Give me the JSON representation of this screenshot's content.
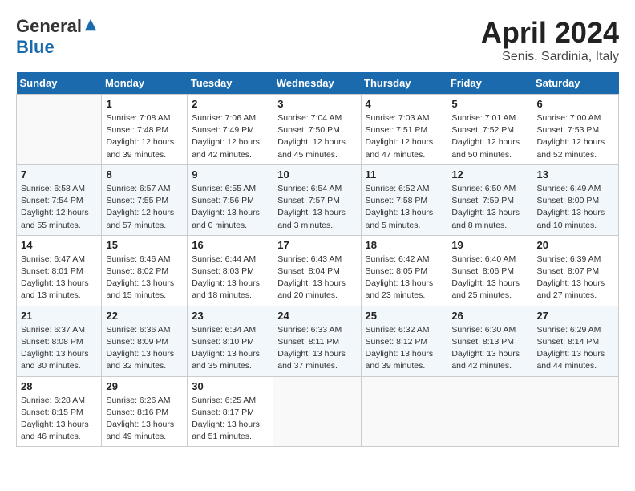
{
  "header": {
    "logo_general": "General",
    "logo_blue": "Blue",
    "month_title": "April 2024",
    "subtitle": "Senis, Sardinia, Italy"
  },
  "days_of_week": [
    "Sunday",
    "Monday",
    "Tuesday",
    "Wednesday",
    "Thursday",
    "Friday",
    "Saturday"
  ],
  "weeks": [
    [
      {
        "day": "",
        "empty": true
      },
      {
        "day": "1",
        "sunrise": "Sunrise: 7:08 AM",
        "sunset": "Sunset: 7:48 PM",
        "daylight": "Daylight: 12 hours and 39 minutes."
      },
      {
        "day": "2",
        "sunrise": "Sunrise: 7:06 AM",
        "sunset": "Sunset: 7:49 PM",
        "daylight": "Daylight: 12 hours and 42 minutes."
      },
      {
        "day": "3",
        "sunrise": "Sunrise: 7:04 AM",
        "sunset": "Sunset: 7:50 PM",
        "daylight": "Daylight: 12 hours and 45 minutes."
      },
      {
        "day": "4",
        "sunrise": "Sunrise: 7:03 AM",
        "sunset": "Sunset: 7:51 PM",
        "daylight": "Daylight: 12 hours and 47 minutes."
      },
      {
        "day": "5",
        "sunrise": "Sunrise: 7:01 AM",
        "sunset": "Sunset: 7:52 PM",
        "daylight": "Daylight: 12 hours and 50 minutes."
      },
      {
        "day": "6",
        "sunrise": "Sunrise: 7:00 AM",
        "sunset": "Sunset: 7:53 PM",
        "daylight": "Daylight: 12 hours and 52 minutes."
      }
    ],
    [
      {
        "day": "7",
        "sunrise": "Sunrise: 6:58 AM",
        "sunset": "Sunset: 7:54 PM",
        "daylight": "Daylight: 12 hours and 55 minutes."
      },
      {
        "day": "8",
        "sunrise": "Sunrise: 6:57 AM",
        "sunset": "Sunset: 7:55 PM",
        "daylight": "Daylight: 12 hours and 57 minutes."
      },
      {
        "day": "9",
        "sunrise": "Sunrise: 6:55 AM",
        "sunset": "Sunset: 7:56 PM",
        "daylight": "Daylight: 13 hours and 0 minutes."
      },
      {
        "day": "10",
        "sunrise": "Sunrise: 6:54 AM",
        "sunset": "Sunset: 7:57 PM",
        "daylight": "Daylight: 13 hours and 3 minutes."
      },
      {
        "day": "11",
        "sunrise": "Sunrise: 6:52 AM",
        "sunset": "Sunset: 7:58 PM",
        "daylight": "Daylight: 13 hours and 5 minutes."
      },
      {
        "day": "12",
        "sunrise": "Sunrise: 6:50 AM",
        "sunset": "Sunset: 7:59 PM",
        "daylight": "Daylight: 13 hours and 8 minutes."
      },
      {
        "day": "13",
        "sunrise": "Sunrise: 6:49 AM",
        "sunset": "Sunset: 8:00 PM",
        "daylight": "Daylight: 13 hours and 10 minutes."
      }
    ],
    [
      {
        "day": "14",
        "sunrise": "Sunrise: 6:47 AM",
        "sunset": "Sunset: 8:01 PM",
        "daylight": "Daylight: 13 hours and 13 minutes."
      },
      {
        "day": "15",
        "sunrise": "Sunrise: 6:46 AM",
        "sunset": "Sunset: 8:02 PM",
        "daylight": "Daylight: 13 hours and 15 minutes."
      },
      {
        "day": "16",
        "sunrise": "Sunrise: 6:44 AM",
        "sunset": "Sunset: 8:03 PM",
        "daylight": "Daylight: 13 hours and 18 minutes."
      },
      {
        "day": "17",
        "sunrise": "Sunrise: 6:43 AM",
        "sunset": "Sunset: 8:04 PM",
        "daylight": "Daylight: 13 hours and 20 minutes."
      },
      {
        "day": "18",
        "sunrise": "Sunrise: 6:42 AM",
        "sunset": "Sunset: 8:05 PM",
        "daylight": "Daylight: 13 hours and 23 minutes."
      },
      {
        "day": "19",
        "sunrise": "Sunrise: 6:40 AM",
        "sunset": "Sunset: 8:06 PM",
        "daylight": "Daylight: 13 hours and 25 minutes."
      },
      {
        "day": "20",
        "sunrise": "Sunrise: 6:39 AM",
        "sunset": "Sunset: 8:07 PM",
        "daylight": "Daylight: 13 hours and 27 minutes."
      }
    ],
    [
      {
        "day": "21",
        "sunrise": "Sunrise: 6:37 AM",
        "sunset": "Sunset: 8:08 PM",
        "daylight": "Daylight: 13 hours and 30 minutes."
      },
      {
        "day": "22",
        "sunrise": "Sunrise: 6:36 AM",
        "sunset": "Sunset: 8:09 PM",
        "daylight": "Daylight: 13 hours and 32 minutes."
      },
      {
        "day": "23",
        "sunrise": "Sunrise: 6:34 AM",
        "sunset": "Sunset: 8:10 PM",
        "daylight": "Daylight: 13 hours and 35 minutes."
      },
      {
        "day": "24",
        "sunrise": "Sunrise: 6:33 AM",
        "sunset": "Sunset: 8:11 PM",
        "daylight": "Daylight: 13 hours and 37 minutes."
      },
      {
        "day": "25",
        "sunrise": "Sunrise: 6:32 AM",
        "sunset": "Sunset: 8:12 PM",
        "daylight": "Daylight: 13 hours and 39 minutes."
      },
      {
        "day": "26",
        "sunrise": "Sunrise: 6:30 AM",
        "sunset": "Sunset: 8:13 PM",
        "daylight": "Daylight: 13 hours and 42 minutes."
      },
      {
        "day": "27",
        "sunrise": "Sunrise: 6:29 AM",
        "sunset": "Sunset: 8:14 PM",
        "daylight": "Daylight: 13 hours and 44 minutes."
      }
    ],
    [
      {
        "day": "28",
        "sunrise": "Sunrise: 6:28 AM",
        "sunset": "Sunset: 8:15 PM",
        "daylight": "Daylight: 13 hours and 46 minutes."
      },
      {
        "day": "29",
        "sunrise": "Sunrise: 6:26 AM",
        "sunset": "Sunset: 8:16 PM",
        "daylight": "Daylight: 13 hours and 49 minutes."
      },
      {
        "day": "30",
        "sunrise": "Sunrise: 6:25 AM",
        "sunset": "Sunset: 8:17 PM",
        "daylight": "Daylight: 13 hours and 51 minutes."
      },
      {
        "day": "",
        "empty": true
      },
      {
        "day": "",
        "empty": true
      },
      {
        "day": "",
        "empty": true
      },
      {
        "day": "",
        "empty": true
      }
    ]
  ]
}
